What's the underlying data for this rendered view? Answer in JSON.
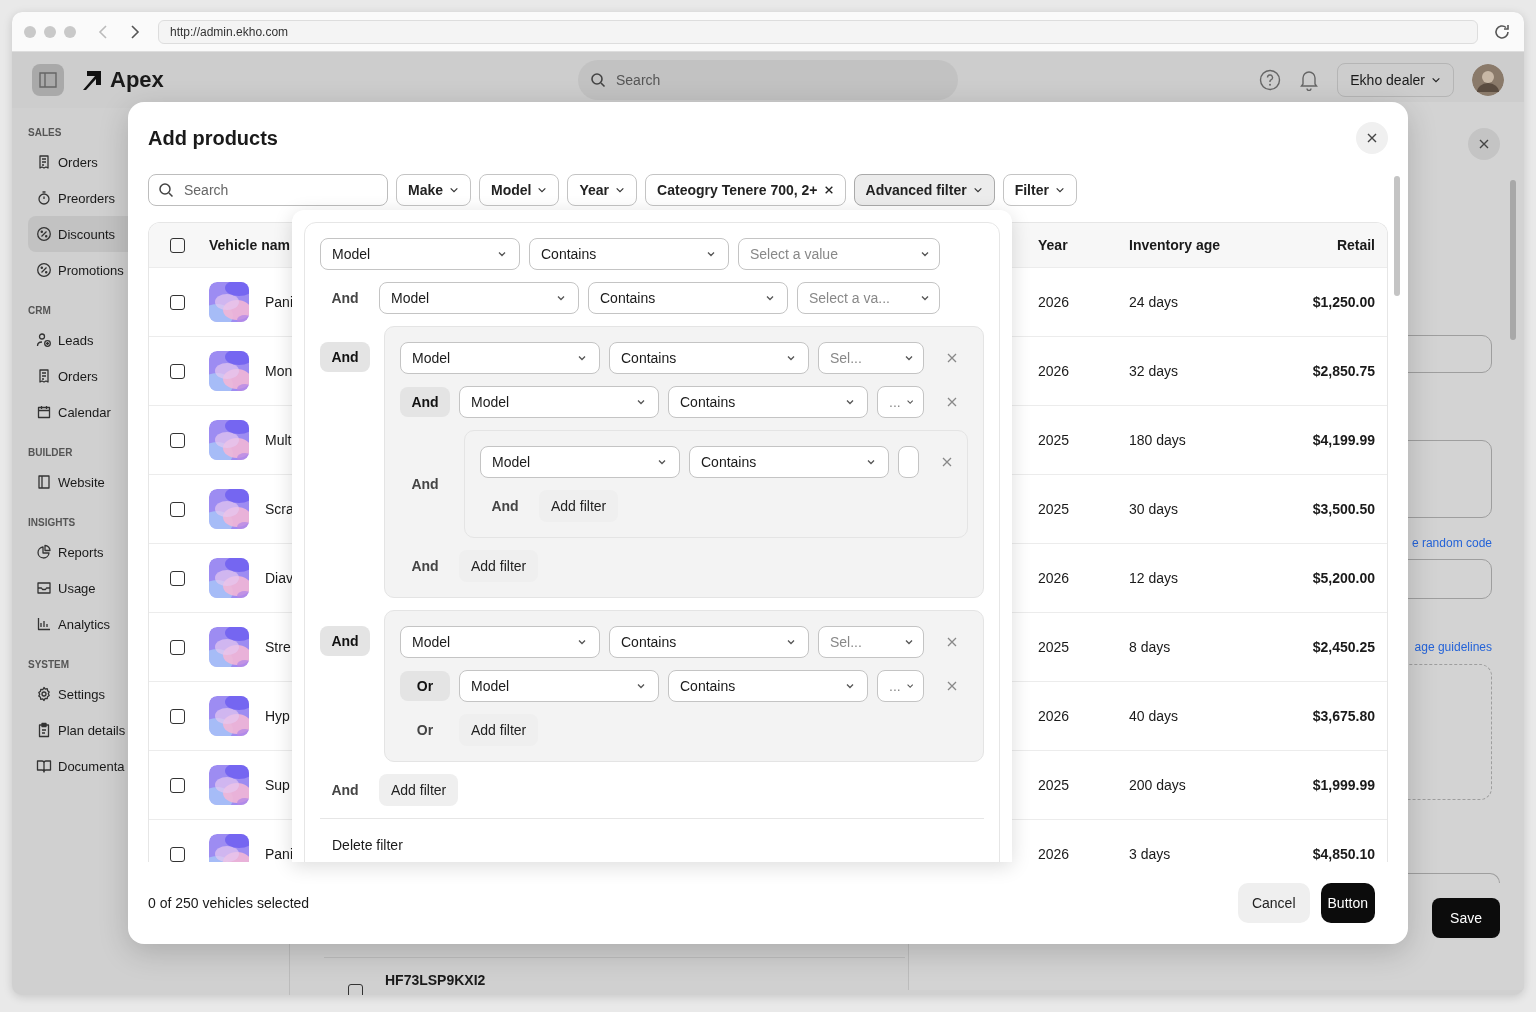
{
  "browser": {
    "url": "http://admin.ekho.com"
  },
  "app_header": {
    "brand": "Apex",
    "search_placeholder": "Search",
    "account": "Ekho dealer"
  },
  "sidebar": {
    "sections": [
      {
        "title": "SALES",
        "items": [
          {
            "label": "Orders",
            "selected": false
          },
          {
            "label": "Preorders",
            "selected": false
          },
          {
            "label": "Discounts",
            "selected": true
          },
          {
            "label": "Promotions",
            "selected": false
          }
        ]
      },
      {
        "title": "CRM",
        "items": [
          {
            "label": "Leads",
            "selected": false
          },
          {
            "label": "Orders",
            "selected": false
          },
          {
            "label": "Calendar",
            "selected": false
          }
        ]
      },
      {
        "title": "BUILDER",
        "items": [
          {
            "label": "Website",
            "selected": false
          }
        ]
      },
      {
        "title": "INSIGHTS",
        "items": [
          {
            "label": "Reports",
            "selected": false
          },
          {
            "label": "Usage",
            "selected": false
          },
          {
            "label": "Analytics",
            "selected": false
          }
        ]
      },
      {
        "title": "SYSTEM",
        "items": [
          {
            "label": "Settings",
            "selected": false
          },
          {
            "label": "Plan details",
            "selected": false
          },
          {
            "label": "Documenta",
            "selected": false
          }
        ]
      }
    ]
  },
  "background_list": {
    "rows": [
      {
        "code": "HF73LSP9KXI2",
        "checked": false
      }
    ]
  },
  "drawer": {
    "links": [
      "e random code",
      "age guidelines"
    ],
    "save": "Save"
  },
  "modal": {
    "title": "Add products",
    "search_placeholder": "Search",
    "chips": [
      {
        "label": "Make",
        "kind": "dropdown",
        "selected": false
      },
      {
        "label": "Model",
        "kind": "dropdown",
        "selected": false
      },
      {
        "label": "Year",
        "kind": "dropdown",
        "selected": false
      },
      {
        "label": "Cateogry Tenere 700, 2+",
        "kind": "removable",
        "selected": false
      },
      {
        "label": "Advanced filter",
        "kind": "dropdown",
        "selected": true
      },
      {
        "label": "Filter",
        "kind": "dropdown",
        "selected": false
      }
    ],
    "table": {
      "columns": [
        "Vehicle nam",
        "Year",
        "Inventory age",
        "Retail"
      ],
      "header_checked": false,
      "rows": [
        {
          "checked": false,
          "name": "Pani",
          "year": "2026",
          "inventory_age": "24 days",
          "retail": "$1,250.00"
        },
        {
          "checked": false,
          "name": "Mon",
          "year": "2026",
          "inventory_age": "32 days",
          "retail": "$2,850.75"
        },
        {
          "checked": false,
          "name": "Mult",
          "year": "2025",
          "inventory_age": "180 days",
          "retail": "$4,199.99"
        },
        {
          "checked": false,
          "name": "Scra",
          "year": "2025",
          "inventory_age": "30 days",
          "retail": "$3,500.50"
        },
        {
          "checked": false,
          "name": "Diav",
          "year": "2026",
          "inventory_age": "12 days",
          "retail": "$5,200.00"
        },
        {
          "checked": false,
          "name": "Stre",
          "year": "2025",
          "inventory_age": "8 days",
          "retail": "$2,450.25"
        },
        {
          "checked": false,
          "name": "Hyp",
          "year": "2026",
          "inventory_age": "40 days",
          "retail": "$3,675.80"
        },
        {
          "checked": false,
          "name": "Sup",
          "year": "2025",
          "inventory_age": "200 days",
          "retail": "$1,999.99"
        },
        {
          "checked": false,
          "name": "Pani",
          "year": "2026",
          "inventory_age": "3 days",
          "retail": "$4,850.10"
        }
      ]
    },
    "filter": {
      "rows": [
        {
          "kind": "condition",
          "field": "Model",
          "operator": "Contains",
          "value": "Select a value",
          "removable": false
        },
        {
          "kind": "condition",
          "connector": {
            "label": "And",
            "kind": "text"
          },
          "field": "Model",
          "operator": "Contains",
          "value": "Select a va...",
          "removable": false
        },
        {
          "kind": "group",
          "connector": {
            "label": "And",
            "kind": "pill"
          },
          "rows": [
            {
              "kind": "condition",
              "field": "Model",
              "operator": "Contains",
              "value": "Sel...",
              "removable": true
            },
            {
              "kind": "condition",
              "connector": {
                "label": "And",
                "kind": "pill"
              },
              "field": "Model",
              "operator": "Contains",
              "value": "...",
              "removable": true
            },
            {
              "kind": "group",
              "connector": {
                "label": "And",
                "kind": "text"
              },
              "rows": [
                {
                  "kind": "condition",
                  "field": "Model",
                  "operator": "Contains",
                  "removable": true
                },
                {
                  "kind": "add",
                  "connector": {
                    "label": "And",
                    "kind": "text"
                  },
                  "label": "Add filter"
                }
              ]
            },
            {
              "kind": "add",
              "connector": {
                "label": "And",
                "kind": "text"
              },
              "label": "Add filter"
            }
          ]
        },
        {
          "kind": "group",
          "connector": {
            "label": "And",
            "kind": "pill"
          },
          "rows": [
            {
              "kind": "condition",
              "field": "Model",
              "operator": "Contains",
              "value": "Sel...",
              "removable": true
            },
            {
              "kind": "condition",
              "connector": {
                "label": "Or",
                "kind": "pill"
              },
              "field": "Model",
              "operator": "Contains",
              "value": "...",
              "removable": true
            },
            {
              "kind": "add",
              "connector": {
                "label": "Or",
                "kind": "text"
              },
              "label": "Add filter"
            }
          ]
        },
        {
          "kind": "add",
          "connector": {
            "label": "And",
            "kind": "text"
          },
          "label": "Add filter"
        }
      ],
      "delete_label": "Delete filter"
    },
    "footer": {
      "status": "0 of 250 vehicles selected",
      "cancel": "Cancel",
      "confirm": "Button"
    }
  }
}
